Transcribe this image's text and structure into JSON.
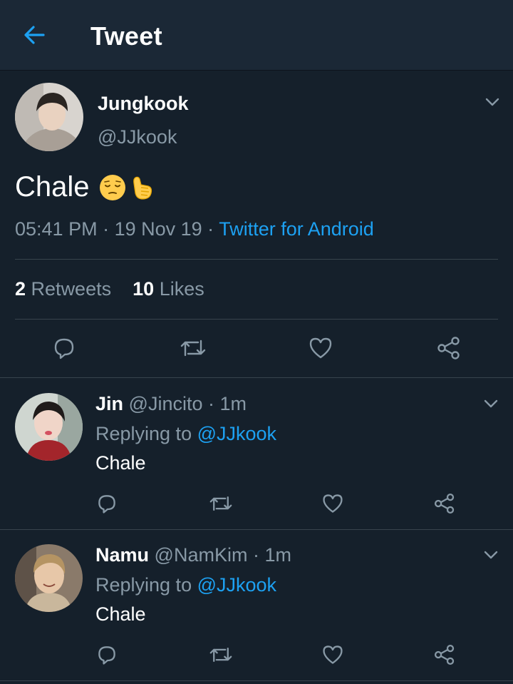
{
  "header": {
    "title": "Tweet",
    "back_icon": "arrow-left-icon"
  },
  "colors": {
    "background": "#15202b",
    "header": "#1b2836",
    "accent": "#1da1f2",
    "muted": "#8899a6",
    "divider": "#38444d"
  },
  "tweet": {
    "name": "Jungkook",
    "handle": "@JJkook",
    "text": "Chale",
    "emojis": [
      "pensive-face-emoji",
      "call-me-hand-emoji"
    ],
    "time": "05:41 PM",
    "sep1": " · ",
    "date": "19 Nov 19",
    "sep2": " · ",
    "source": "Twitter for Android",
    "retweets_count": "2",
    "retweets_label": "Retweets",
    "likes_count": "10",
    "likes_label": "Likes",
    "actions": [
      "reply-icon",
      "retweet-icon",
      "like-icon",
      "share-icon"
    ]
  },
  "replies": [
    {
      "name": "Jin",
      "handle": "@Jincito",
      "time": "1m",
      "replying_prefix": "Replying to",
      "replying_to": "@JJkook",
      "text": "Chale"
    },
    {
      "name": "Namu",
      "handle": "@NamKim",
      "time": "1m",
      "replying_prefix": "Replying to",
      "replying_to": "@JJkook",
      "text": "Chale"
    }
  ]
}
